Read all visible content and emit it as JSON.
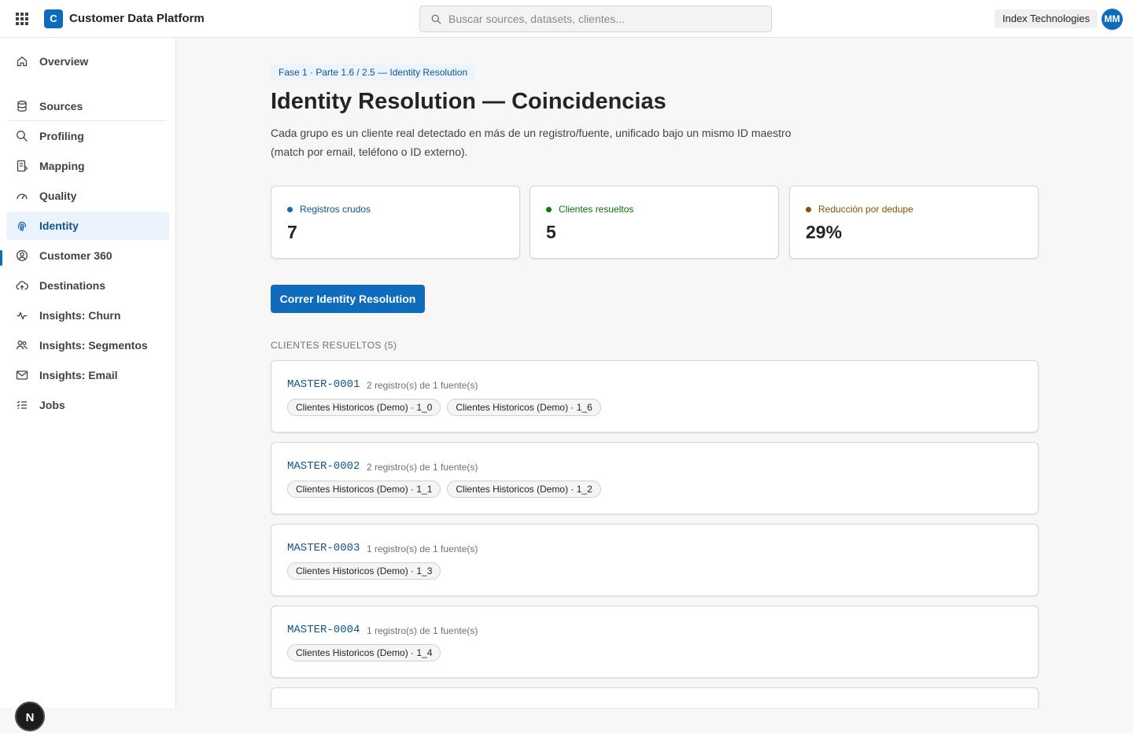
{
  "topbar": {
    "app_logo_letter": "C",
    "app_title": "Customer Data Platform",
    "search_placeholder": "Buscar sources, datasets, clientes...",
    "tenant": "Index Technologies",
    "avatar_initials": "MM"
  },
  "sidebar": {
    "items": [
      {
        "label": "Overview",
        "icon": "home-icon"
      },
      {
        "label": "Sources",
        "icon": "database-icon"
      },
      {
        "label": "Profiling",
        "icon": "search-icon"
      },
      {
        "label": "Mapping",
        "icon": "mapping-icon"
      },
      {
        "label": "Quality",
        "icon": "gauge-icon"
      },
      {
        "label": "Identity",
        "icon": "fingerprint-icon",
        "active": true
      },
      {
        "label": "Customer 360",
        "icon": "person-circle-icon"
      },
      {
        "label": "Destinations",
        "icon": "cloud-upload-icon"
      },
      {
        "label": "Insights: Churn",
        "icon": "pulse-icon"
      },
      {
        "label": "Insights: Segmentos",
        "icon": "people-icon"
      },
      {
        "label": "Insights: Email",
        "icon": "mail-icon"
      },
      {
        "label": "Jobs",
        "icon": "task-list-icon"
      }
    ],
    "dev_badge": "N"
  },
  "main": {
    "phase": "Fase 1 · Parte 1.6 / 2.5 — Identity Resolution",
    "title": "Identity Resolution — Coincidencias",
    "description": "Cada grupo es un cliente real detectado en más de un registro/fuente, unificado bajo un mismo ID maestro (match por email, teléfono o ID externo).",
    "kpis": [
      {
        "label": "Registros crudos",
        "value": "7",
        "color": "#0f6cbd"
      },
      {
        "label": "Clientes resueltos",
        "value": "5",
        "color": "#107c10"
      },
      {
        "label": "Reducción por dedupe",
        "value": "29%",
        "color": "#8a5100"
      }
    ],
    "run_button": "Correr Identity Resolution",
    "section_title": "CLIENTES RESUELTOS (5)",
    "clients": [
      {
        "id": "MASTER-0001",
        "meta": "2 registro(s) de 1 fuente(s)",
        "records": [
          "Clientes Historicos (Demo) · 1_0",
          "Clientes Historicos (Demo) · 1_6"
        ]
      },
      {
        "id": "MASTER-0002",
        "meta": "2 registro(s) de 1 fuente(s)",
        "records": [
          "Clientes Historicos (Demo) · 1_1",
          "Clientes Historicos (Demo) · 1_2"
        ]
      },
      {
        "id": "MASTER-0003",
        "meta": "1 registro(s) de 1 fuente(s)",
        "records": [
          "Clientes Historicos (Demo) · 1_3"
        ]
      },
      {
        "id": "MASTER-0004",
        "meta": "1 registro(s) de 1 fuente(s)",
        "records": [
          "Clientes Historicos (Demo) · 1_4"
        ]
      }
    ]
  },
  "colors": {
    "accent": "#0f6cbd",
    "accent_dark": "#0f548c",
    "active_nav_bg": "#ebf3fc"
  }
}
